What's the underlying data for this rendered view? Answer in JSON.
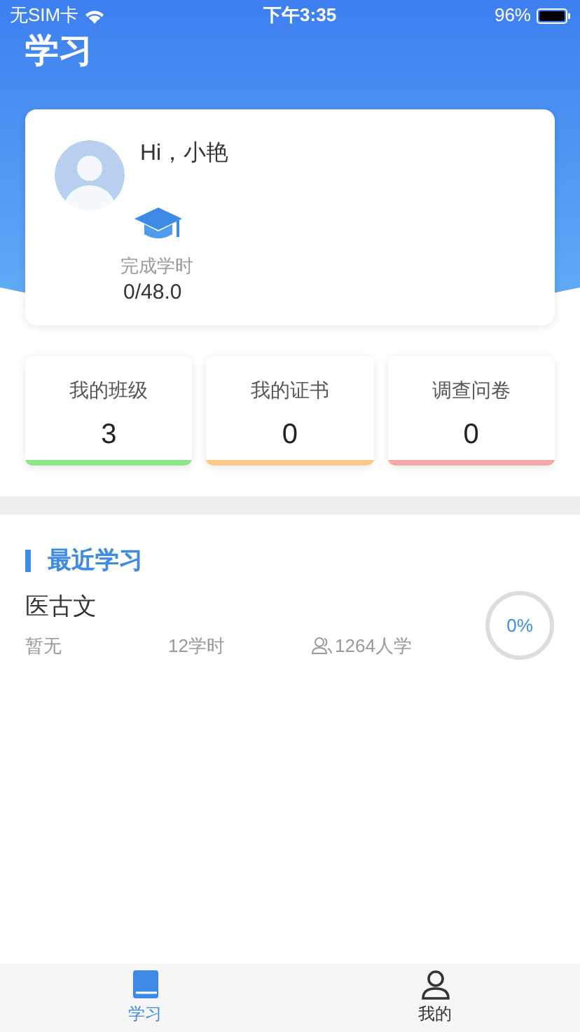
{
  "status_bar": {
    "carrier": "无SIM卡",
    "time": "下午3:35",
    "battery": "96%"
  },
  "header": {
    "title": "学习"
  },
  "profile": {
    "greeting": "Hi，小艳",
    "hours_label": "完成学时",
    "hours_value": "0/48.0"
  },
  "stats": [
    {
      "label": "我的班级",
      "value": "3",
      "color": "#8ee68a"
    },
    {
      "label": "我的证书",
      "value": "0",
      "color": "#f7c98a"
    },
    {
      "label": "调查问卷",
      "value": "0",
      "color": "#f2aaa8"
    }
  ],
  "recent": {
    "title": "最近学习",
    "courses": [
      {
        "name": "医古文",
        "teacher": "暂无",
        "hours": "12学时",
        "learners": "1264人学",
        "progress_text": "0%",
        "level": 0
      }
    ]
  },
  "tab_bar": [
    {
      "label": "学习",
      "selected": true
    },
    {
      "label": "我的",
      "selected": false
    }
  ]
}
